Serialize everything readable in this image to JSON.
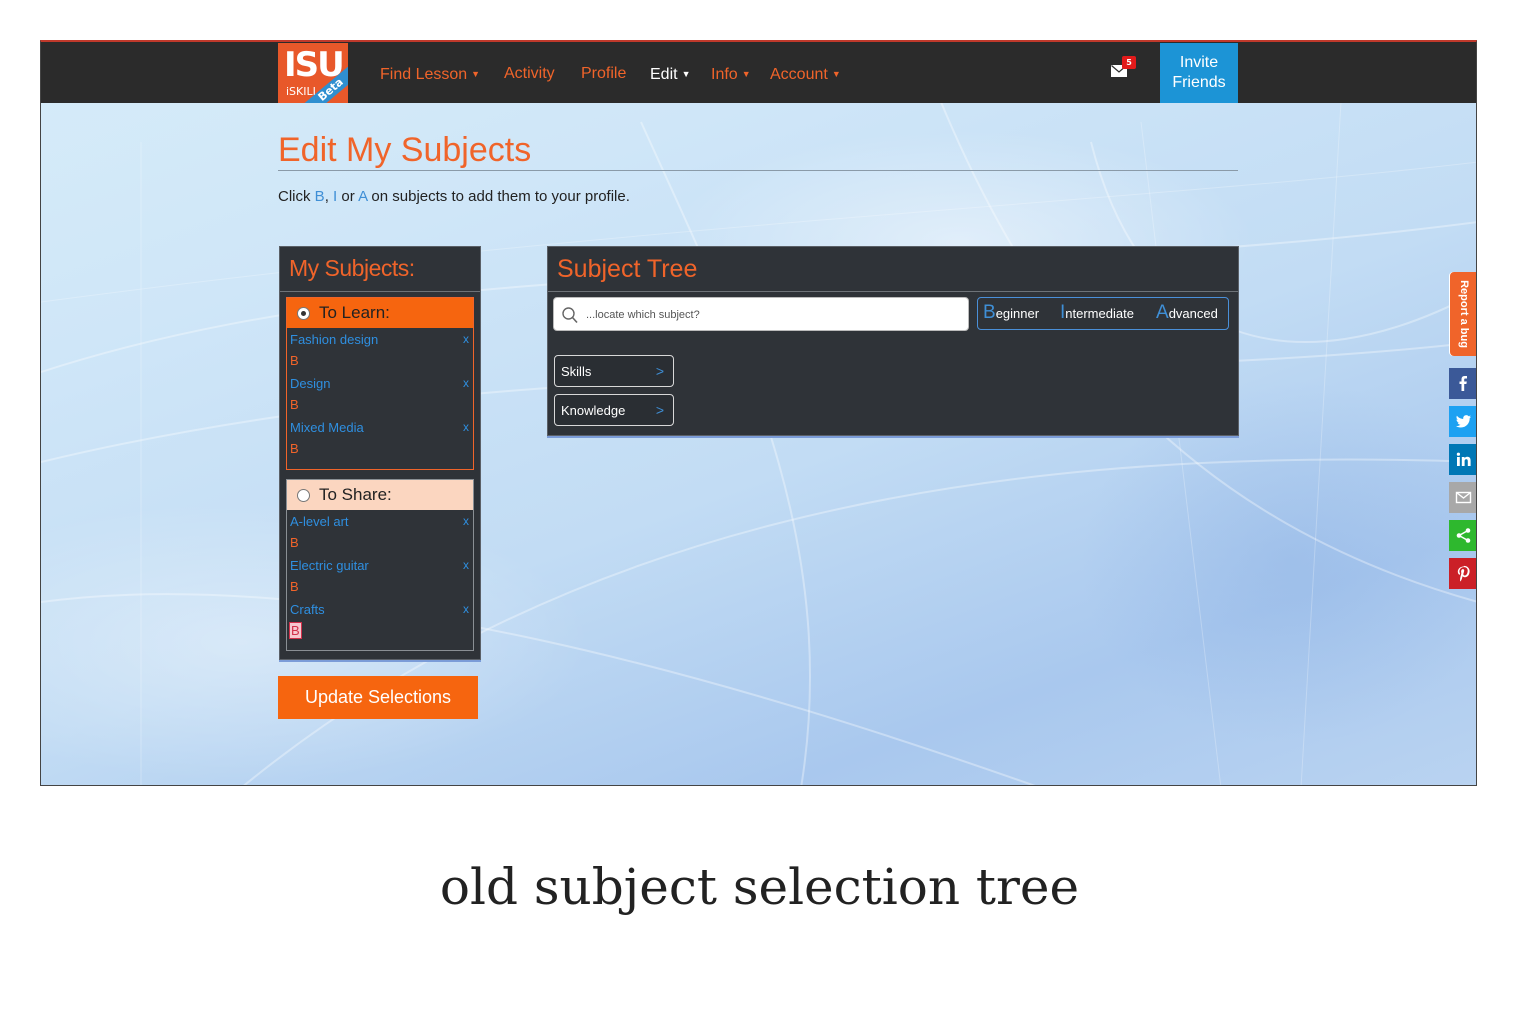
{
  "colors": {
    "accent": "#f0642a",
    "link_blue": "#2f8fe0",
    "invite_blue": "#1c94d6",
    "nav_bg": "#2b2b2b",
    "panel_bg": "#2f3338"
  },
  "logo": {
    "mark": "ISU",
    "sub": "iSKILL",
    "badge": "Beta"
  },
  "nav": {
    "items": [
      {
        "label": "Find Lesson",
        "dropdown": true
      },
      {
        "label": "Activity",
        "dropdown": false
      },
      {
        "label": "Profile",
        "dropdown": false
      },
      {
        "label": "Edit",
        "dropdown": true
      },
      {
        "label": "Info",
        "dropdown": true
      },
      {
        "label": "Account",
        "dropdown": true
      }
    ],
    "mail_badge": "5",
    "invite_line1": "Invite",
    "invite_line2": "Friends"
  },
  "page": {
    "title": "Edit My Subjects",
    "intro_prefix": "Click ",
    "intro_b": "B",
    "intro_sep1": ", ",
    "intro_i": "I",
    "intro_or": " or ",
    "intro_a": "A",
    "intro_suffix": " on subjects to add them to your profile."
  },
  "my_subjects": {
    "title": "My Subjects:",
    "to_learn": {
      "label": "To Learn:",
      "selected": true,
      "items": [
        {
          "name": "Fashion design",
          "remove": "x",
          "level": "B"
        },
        {
          "name": "Design",
          "remove": "x",
          "level": "B"
        },
        {
          "name": "Mixed Media",
          "remove": "x",
          "level": "B"
        }
      ]
    },
    "to_share": {
      "label": "To Share:",
      "selected": false,
      "items": [
        {
          "name": "A-level art",
          "remove": "x",
          "level": "B"
        },
        {
          "name": "Electric guitar",
          "remove": "x",
          "level": "B"
        },
        {
          "name": "Crafts",
          "remove": "x",
          "level": "B"
        }
      ]
    },
    "update_button": "Update Selections"
  },
  "subject_tree": {
    "title": "Subject Tree",
    "search_placeholder": "...locate which subject?",
    "levels": [
      {
        "cap": "B",
        "rest": "eginner"
      },
      {
        "cap": "I",
        "rest": "ntermediate"
      },
      {
        "cap": "A",
        "rest": "dvanced"
      }
    ],
    "nodes": [
      {
        "label": "Skills",
        "arrow": ">"
      },
      {
        "label": "Knowledge",
        "arrow": ">"
      }
    ]
  },
  "sidebar": {
    "report_bug": "Report a bug",
    "share_buttons": [
      {
        "icon": "facebook-icon",
        "color": "#3b5998"
      },
      {
        "icon": "twitter-icon",
        "color": "#1da1f2"
      },
      {
        "icon": "linkedin-icon",
        "color": "#0077b5"
      },
      {
        "icon": "email-icon",
        "color": "#a8a8a8"
      },
      {
        "icon": "share-icon",
        "color": "#2eb82e"
      },
      {
        "icon": "pinterest-icon",
        "color": "#cb2027"
      }
    ]
  },
  "caption": "old subject selection tree"
}
